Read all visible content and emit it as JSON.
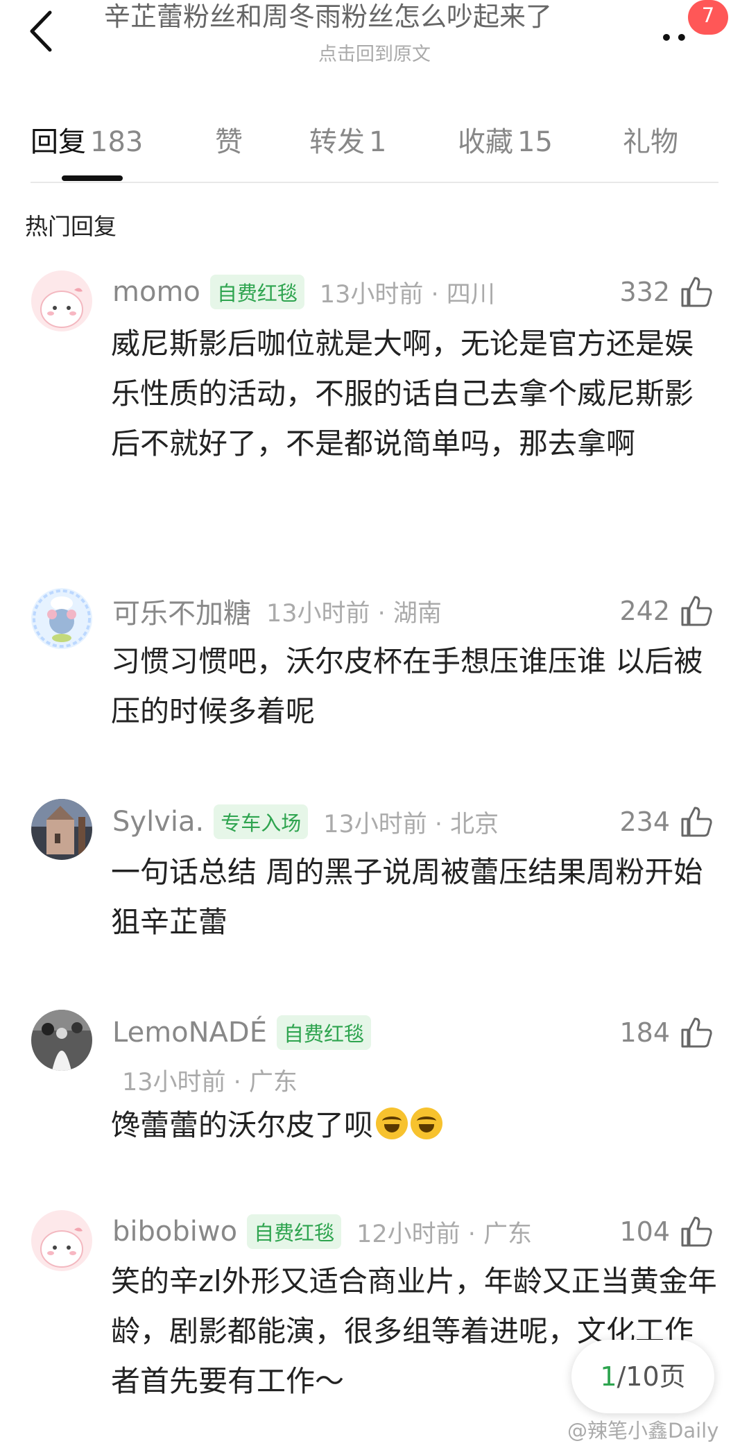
{
  "header": {
    "title": "辛芷蕾粉丝和周冬雨粉丝怎么吵起来了",
    "subtitle": "点击回到原文",
    "badge": "7"
  },
  "tabs": [
    {
      "label": "回复",
      "count": "183"
    },
    {
      "label": "赞",
      "count": ""
    },
    {
      "label": "转发",
      "count": "1"
    },
    {
      "label": "收藏",
      "count": "15"
    },
    {
      "label": "礼物",
      "count": ""
    }
  ],
  "section_title": "热门回复",
  "comments": [
    {
      "user": "momo",
      "tag": "自费红毯",
      "time": "13小时前 · 四川",
      "likes": "332",
      "text": "威尼斯影后咖位就是大啊，无论是官方还是娱乐性质的活动，不服的话自己去拿个威尼斯影后不就好了，不是都说简单吗，那去拿啊"
    },
    {
      "user": "可乐不加糖",
      "tag": "",
      "time": "13小时前 · 湖南",
      "likes": "242",
      "text": "习惯习惯吧，沃尔皮杯在手想压谁压谁 以后被压的时候多着呢"
    },
    {
      "user": "Sylvia.",
      "tag": "专车入场",
      "time": "13小时前 · 北京",
      "likes": "234",
      "text": "一句话总结 周的黑子说周被蕾压结果周粉开始狙辛芷蕾"
    },
    {
      "user": "LemoNADÉ",
      "tag": "自费红毯",
      "time": "13小时前 · 广东",
      "likes": "184",
      "text": "馋蕾蕾的沃尔皮了呗"
    },
    {
      "user": "bibobiwo",
      "tag": "自费红毯",
      "time": "12小时前 · 广东",
      "likes": "104",
      "text": "笑的辛zl外形又适合商业片，年龄又正当黄金年龄，剧影都能演，很多组等着进呢，文化工作者首先要有工作～"
    }
  ],
  "pager": {
    "current": "1",
    "total_label": "/10页"
  },
  "watermark": "@辣笔小鑫Daily",
  "colors": {
    "accent_green": "#2ea44f",
    "badge_red": "#ff5757",
    "text_grey": "#888888"
  }
}
